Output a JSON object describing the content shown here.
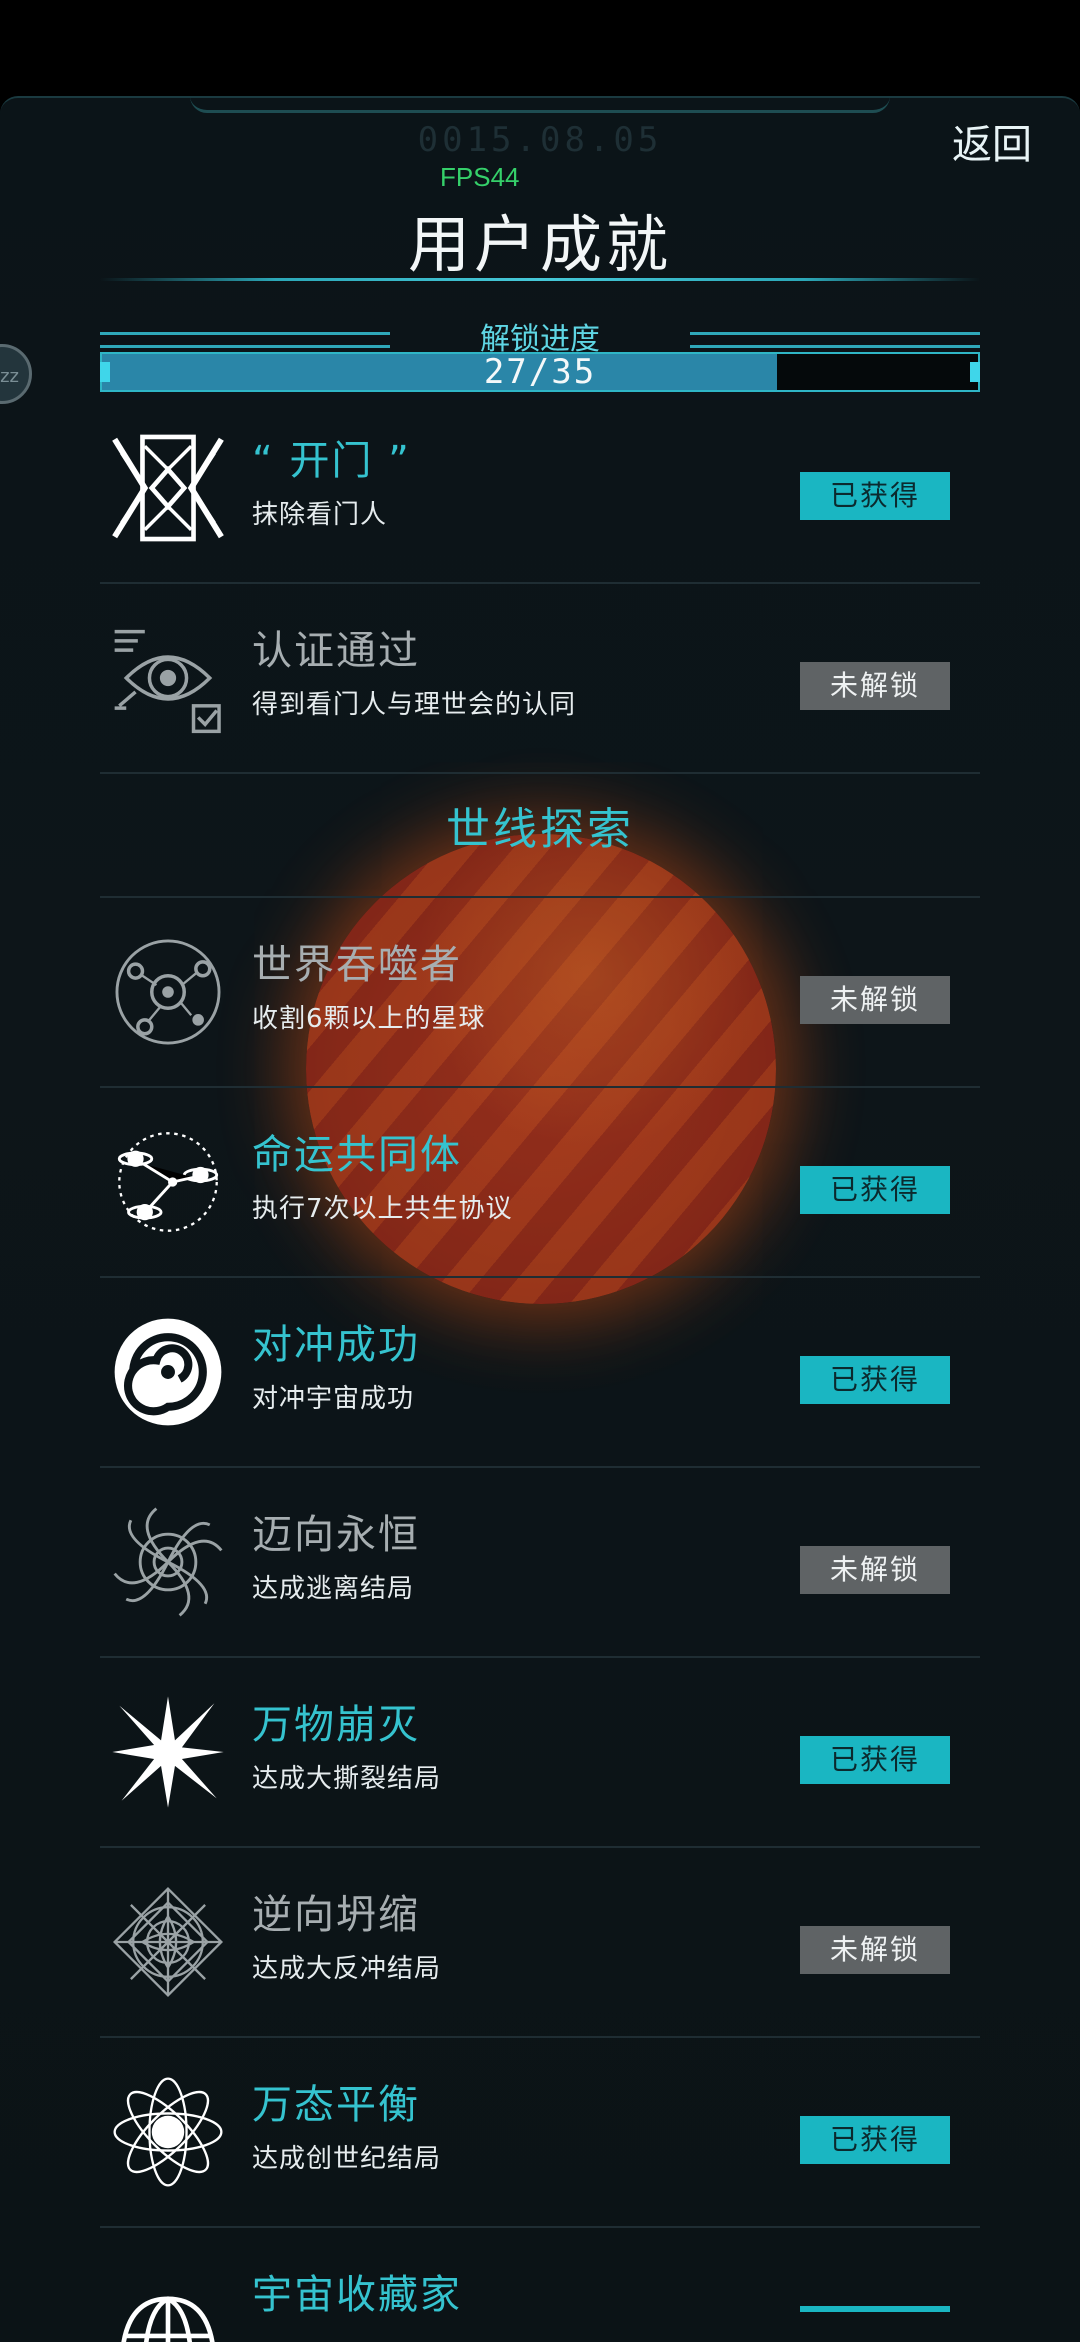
{
  "header": {
    "timestamp": "0015.08.05",
    "fps": "FPS44",
    "back_label": "返回",
    "title": "用户成就"
  },
  "progress": {
    "label": "解锁进度",
    "text": "27/35",
    "fraction": 0.771
  },
  "side_badge": "zz",
  "rows": [
    {
      "name": "“ 开门 ”",
      "desc": "抹除看门人",
      "status": "已获得",
      "state": "unlocked",
      "icon": "gate-icon"
    },
    {
      "name": "认证通过",
      "desc": "得到看门人与理世会的认同",
      "status": "未解锁",
      "state": "locked",
      "icon": "eye-check-icon"
    },
    {
      "section": "世线探索"
    },
    {
      "name": "世界吞噬者",
      "desc": "收割6颗以上的星球",
      "status": "未解锁",
      "state": "locked",
      "icon": "orbit-system-icon"
    },
    {
      "name": "命运共同体",
      "desc": "执行7次以上共生协议",
      "status": "已获得",
      "state": "unlocked",
      "icon": "linked-planets-icon"
    },
    {
      "name": "对冲成功",
      "desc": "对冲宇宙成功",
      "status": "已获得",
      "state": "unlocked",
      "icon": "spiral-vortex-icon"
    },
    {
      "name": "迈向永恒",
      "desc": "达成逃离结局",
      "status": "未解锁",
      "state": "locked",
      "icon": "galaxy-swirl-icon"
    },
    {
      "name": "万物崩灭",
      "desc": "达成大撕裂结局",
      "status": "已获得",
      "state": "unlocked",
      "icon": "burst-icon"
    },
    {
      "name": "逆向坍缩",
      "desc": "达成大反冲结局",
      "status": "未解锁",
      "state": "locked",
      "icon": "mandala-icon"
    },
    {
      "name": "万态平衡",
      "desc": "达成创世纪结局",
      "status": "已获得",
      "state": "unlocked",
      "icon": "atom-orbits-icon"
    },
    {
      "name": "宇宙收藏家",
      "desc": "",
      "status": "",
      "state": "unlocked",
      "icon": "dome-icon"
    }
  ]
}
